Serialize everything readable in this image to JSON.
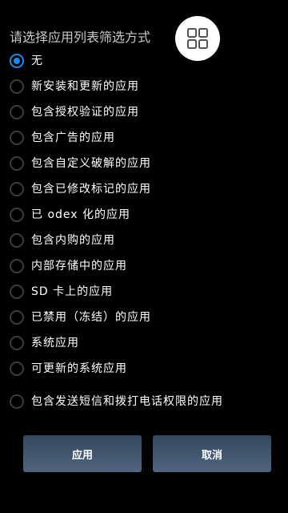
{
  "dialog": {
    "title": "请选择应用列表筛选方式"
  },
  "floating_button": {
    "icon": "grid-icon"
  },
  "accent_color": "#1e88e5",
  "options": [
    {
      "label": "无",
      "selected": true
    },
    {
      "label": "新安装和更新的应用",
      "selected": false
    },
    {
      "label": "包含授权验证的应用",
      "selected": false
    },
    {
      "label": "包含广告的应用",
      "selected": false
    },
    {
      "label": "包含自定义破解的应用",
      "selected": false
    },
    {
      "label": "包含已修改标记的应用",
      "selected": false
    },
    {
      "label": "已 odex 化的应用",
      "selected": false
    },
    {
      "label": "包含内购的应用",
      "selected": false
    },
    {
      "label": "内部存储中的应用",
      "selected": false
    },
    {
      "label": "SD 卡上的应用",
      "selected": false
    },
    {
      "label": "已禁用（冻结）的应用",
      "selected": false
    },
    {
      "label": "系统应用",
      "selected": false
    },
    {
      "label": "可更新的系统应用",
      "selected": false
    },
    {
      "label": "包含发送短信和拨打电话权限的应用",
      "selected": false
    }
  ],
  "buttons": {
    "apply_label": "应用",
    "cancel_label": "取消"
  }
}
